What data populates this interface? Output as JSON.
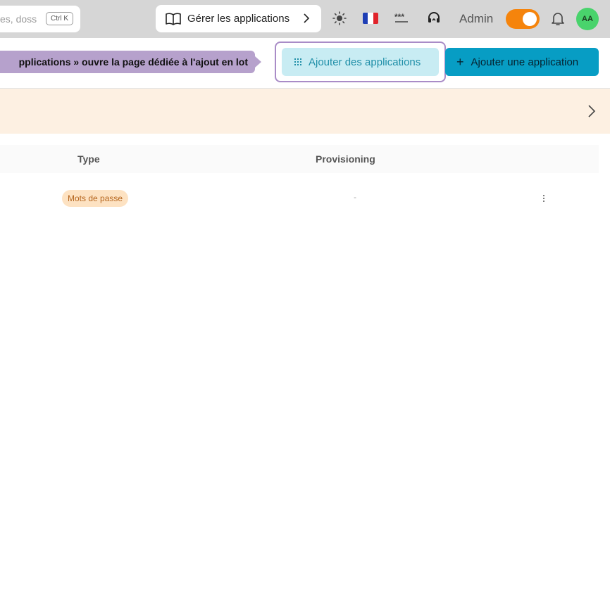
{
  "header": {
    "search": {
      "text": "es, doss",
      "shortcut": "Ctrl K"
    },
    "manage_button": {
      "label": "Gérer les applications"
    },
    "admin_label": "Admin",
    "avatar_initials": "AA",
    "mode_toggle": {
      "state": "on",
      "color": "#f5840c"
    },
    "icons": [
      "book-icon",
      "chevron-right-icon",
      "sun-icon",
      "french-flag-icon",
      "password-dots-icon",
      "support-icon",
      "bell-icon"
    ]
  },
  "actions": {
    "tooltip_text": "pplications » ouvre la page dédiée à l'ajout en lot",
    "bulk_add_label": "Ajouter des applications",
    "add_one_label": "Ajouter une application"
  },
  "table": {
    "columns": {
      "type": "Type",
      "provisioning": "Provisioning"
    },
    "rows": [
      {
        "type": "Mots de passe",
        "provisioning": "-"
      }
    ]
  },
  "colors": {
    "accent": "#079dc4",
    "banner": "#fdf0e2",
    "tooltip": "#b6a1cc",
    "avatar": "#49d36c"
  }
}
